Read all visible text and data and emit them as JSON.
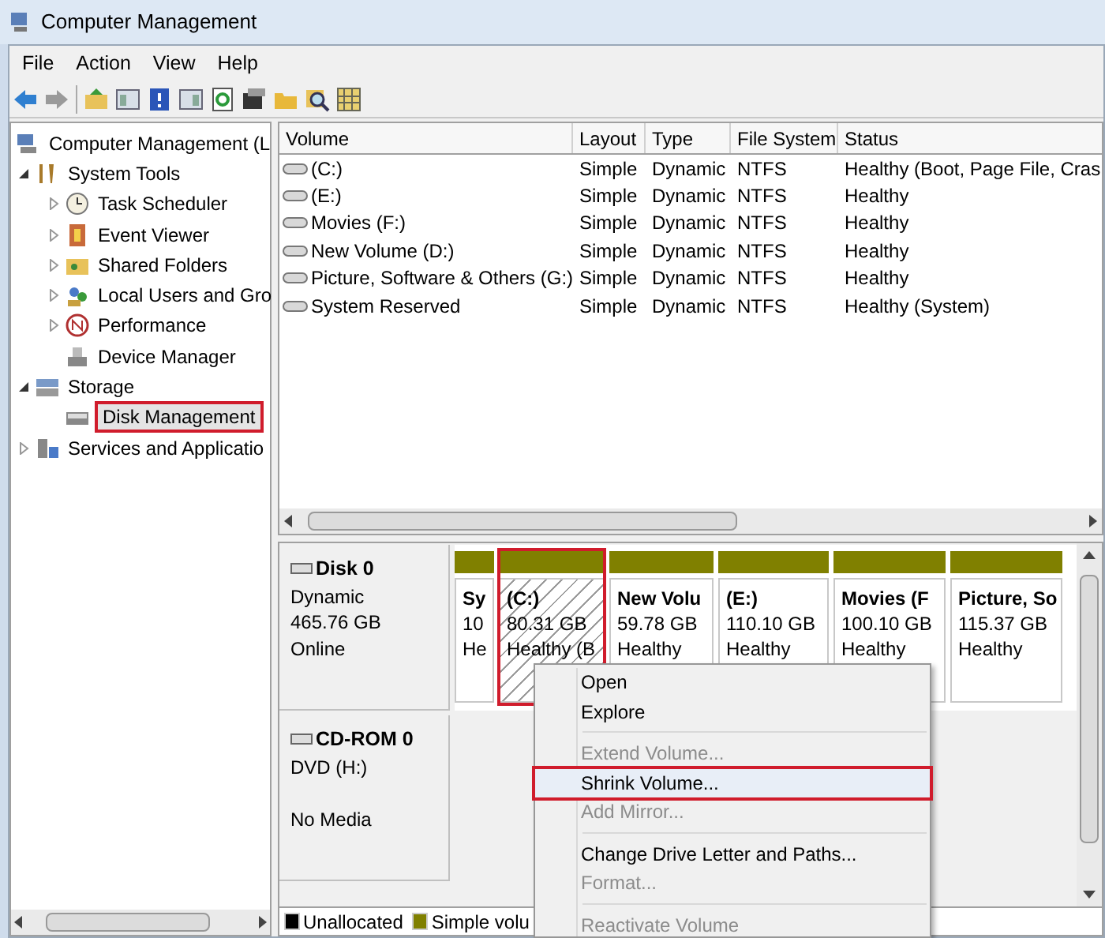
{
  "window": {
    "title": "Computer Management"
  },
  "menu": [
    "File",
    "Action",
    "View",
    "Help"
  ],
  "tree": [
    {
      "label": "Computer Management (L",
      "selected": false,
      "children": [
        {
          "label": "System Tools",
          "expanded": true,
          "selected": false,
          "children": [
            {
              "label": "Task Scheduler",
              "expanded": false,
              "selected": false
            },
            {
              "label": "Event Viewer",
              "expanded": false,
              "selected": false
            },
            {
              "label": "Shared Folders",
              "expanded": false,
              "selected": false
            },
            {
              "label": "Local Users and Gro",
              "expanded": false,
              "selected": false
            },
            {
              "label": "Performance",
              "expanded": false,
              "selected": false
            },
            {
              "label": "Device Manager",
              "selected": false
            }
          ]
        },
        {
          "label": "Storage",
          "expanded": true,
          "selected": false,
          "children": [
            {
              "label": "Disk Management",
              "selected": true,
              "highlighted": true
            }
          ]
        },
        {
          "label": "Services and Applicatio",
          "expanded": false,
          "selected": false
        }
      ]
    }
  ],
  "volume_table": {
    "columns": [
      "Volume",
      "Layout",
      "Type",
      "File System",
      "Status"
    ],
    "rows": [
      [
        "(C:)",
        "Simple",
        "Dynamic",
        "NTFS",
        "Healthy (Boot, Page File, Cras"
      ],
      [
        "(E:)",
        "Simple",
        "Dynamic",
        "NTFS",
        "Healthy"
      ],
      [
        "Movies (F:)",
        "Simple",
        "Dynamic",
        "NTFS",
        "Healthy"
      ],
      [
        "New Volume (D:)",
        "Simple",
        "Dynamic",
        "NTFS",
        "Healthy"
      ],
      [
        "Picture, Software & Others (G:)",
        "Simple",
        "Dynamic",
        "NTFS",
        "Healthy"
      ],
      [
        "System Reserved",
        "Simple",
        "Dynamic",
        "NTFS",
        "Healthy (System)"
      ]
    ]
  },
  "disks": [
    {
      "name": "Disk 0",
      "lines": [
        "Dynamic",
        "465.76 GB",
        "Online"
      ],
      "partitions": [
        {
          "label": "Sy",
          "size": "10",
          "status": "He",
          "selected": false
        },
        {
          "label": "(C:)",
          "size": "80.31 GB",
          "status": "Healthy (B",
          "selected": true,
          "highlighted": true
        },
        {
          "label": "New Volu",
          "size": "59.78 GB",
          "status": "Healthy",
          "selected": false
        },
        {
          "label": "(E:)",
          "size": "110.10 GB",
          "status": "Healthy",
          "selected": false
        },
        {
          "label": "Movies  (F",
          "size": "100.10 GB",
          "status": "Healthy",
          "selected": false
        },
        {
          "label": "Picture, So",
          "size": "115.37 GB",
          "status": "Healthy",
          "selected": false
        }
      ]
    },
    {
      "name": "CD-ROM 0",
      "lines": [
        "DVD (H:)",
        "No Media"
      ]
    }
  ],
  "legend": [
    {
      "label": "Unallocated",
      "color": "#000000"
    },
    {
      "label": "Simple volu",
      "color": "#808000"
    }
  ],
  "context_menu": [
    {
      "kind": "item",
      "label": "Open",
      "disabled": false
    },
    {
      "kind": "item",
      "label": "Explore",
      "disabled": false
    },
    {
      "kind": "separator"
    },
    {
      "kind": "item",
      "label": "Extend Volume...",
      "disabled": true
    },
    {
      "kind": "item",
      "label": "Shrink Volume...",
      "disabled": false,
      "highlighted": true
    },
    {
      "kind": "item",
      "label": "Add Mirror...",
      "disabled": true
    },
    {
      "kind": "separator"
    },
    {
      "kind": "item",
      "label": "Change Drive Letter and Paths...",
      "disabled": false
    },
    {
      "kind": "item",
      "label": "Format...",
      "disabled": true
    },
    {
      "kind": "separator"
    },
    {
      "kind": "item",
      "label": "Reactivate Volume",
      "disabled": true
    }
  ]
}
